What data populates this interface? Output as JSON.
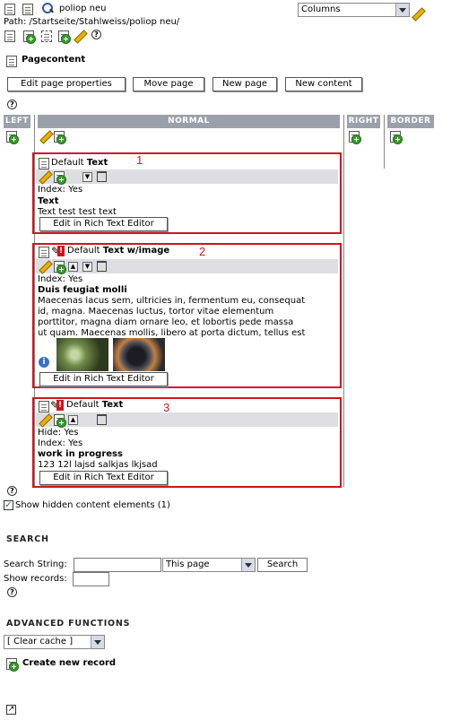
{
  "header": {
    "page_title": "poliop neu",
    "path": "Path: /Startseite/Stahlweiss/poliop neu/",
    "view_select": "Columns"
  },
  "pagecontent": {
    "title": "Pagecontent",
    "buttons": {
      "edit_page_properties": "Edit page properties",
      "move_page": "Move page",
      "new_page": "New page",
      "new_content": "New content"
    }
  },
  "columns": {
    "left": "LEFT",
    "normal": "NORMAL",
    "right": "RIGHT",
    "border": "BORDER"
  },
  "elements": [
    {
      "number": "1",
      "type_prefix": "Default ",
      "type_name": "Text",
      "lines": [
        "Index: Yes"
      ],
      "header": "Text",
      "body": [
        "Text test test text"
      ],
      "rte_button": "Edit in Rich Text Editor"
    },
    {
      "number": "2",
      "type_prefix": "Default ",
      "type_name": "Text w/image",
      "lines": [
        "Index: Yes"
      ],
      "header": "Duis feugiat molli",
      "body": [
        "Maecenas lacus sem, ultricies in, fermentum eu, consequat",
        "id, magna. Maecenas luctus, tortor vitae elementum",
        "porttitor, magna diam ornare leo, et lobortis pede massa",
        "ut quam. Maecenas mollis, libero at porta dictum, tellus est"
      ],
      "rte_button": "Edit in Rich Text Editor"
    },
    {
      "number": "3",
      "type_prefix": "Default ",
      "type_name": "Text",
      "lines": [
        "Hide: Yes",
        "Index: Yes"
      ],
      "header": "work in progress",
      "body": [
        "123 12l lajsd salkjas lkjsad"
      ],
      "rte_button": "Edit in Rich Text Editor"
    }
  ],
  "show_hidden": "Show hidden content elements (1)",
  "search": {
    "title": "SEARCH",
    "string_label": "Search String:",
    "scope": "This page",
    "button": "Search",
    "records_label": "Show records:"
  },
  "advanced": {
    "title": "ADVANCED FUNCTIONS",
    "select": "[ Clear cache ]",
    "create_record": "Create new record"
  },
  "colors": {
    "column_header": "#9ba1aa",
    "toolbar_bg": "#dcdee2",
    "highlight_box": "#d1141b"
  }
}
